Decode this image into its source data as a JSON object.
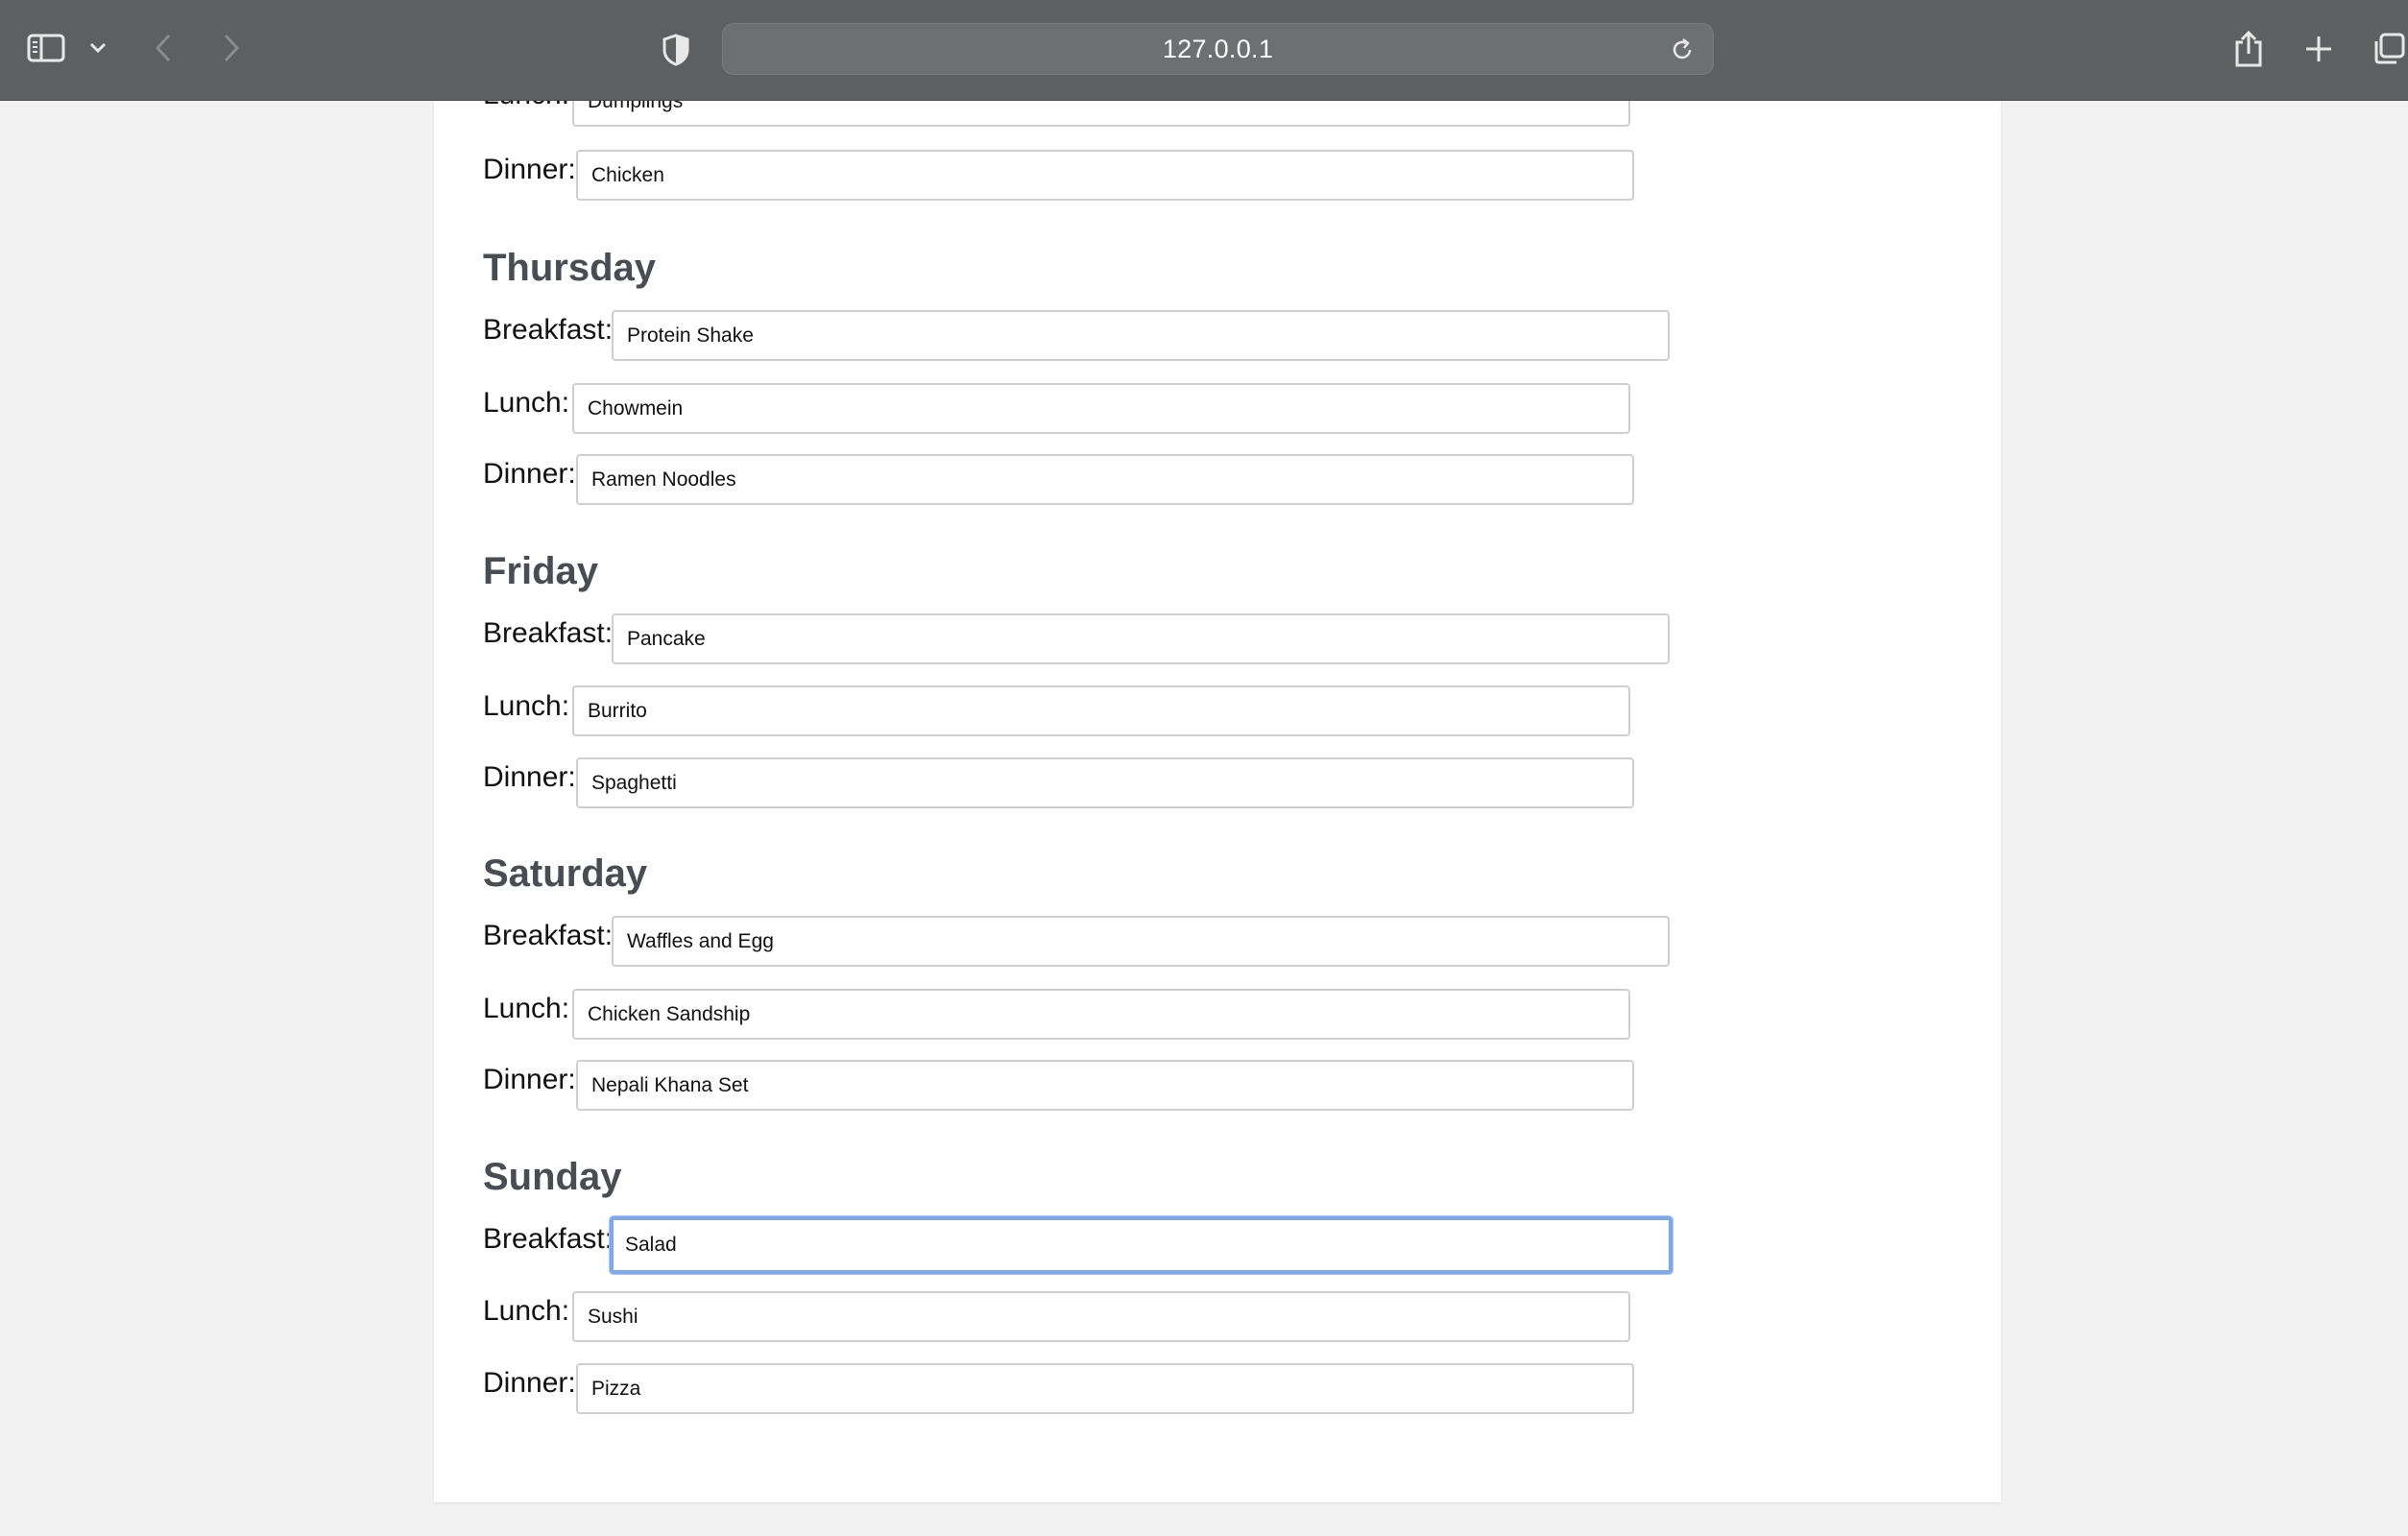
{
  "browser": {
    "url": "127.0.0.1",
    "icons": {
      "sidebar": "sidebar-icon",
      "chevron": "chevron-down-icon",
      "back": "back-icon",
      "forward": "forward-icon",
      "privacy": "shield-icon",
      "reload": "reload-icon",
      "share": "share-icon",
      "new_tab": "plus-icon",
      "tabs": "tab-overview-icon"
    }
  },
  "partial_top": {
    "lunch_label": "Lunch:",
    "lunch_value": "Dumplings",
    "dinner_label": "Dinner:",
    "dinner_value": "Chicken"
  },
  "days": [
    {
      "name": "Thursday",
      "breakfast_label": "Breakfast:",
      "breakfast": "Protein Shake",
      "lunch_label": "Lunch:",
      "lunch": "Chowmein",
      "dinner_label": "Dinner:",
      "dinner": "Ramen Noodles"
    },
    {
      "name": "Friday",
      "breakfast_label": "Breakfast:",
      "breakfast": "Pancake",
      "lunch_label": "Lunch:",
      "lunch": "Burrito",
      "dinner_label": "Dinner:",
      "dinner": "Spaghetti"
    },
    {
      "name": "Saturday",
      "breakfast_label": "Breakfast:",
      "breakfast": "Waffles and Egg",
      "lunch_label": "Lunch:",
      "lunch": "Chicken Sandship",
      "dinner_label": "Dinner:",
      "dinner": "Nepali Khana Set"
    },
    {
      "name": "Sunday",
      "breakfast_label": "Breakfast:",
      "breakfast": "Salad",
      "lunch_label": "Lunch:",
      "lunch": "Sushi",
      "dinner_label": "Dinner:",
      "dinner": "Pizza"
    }
  ],
  "colors": {
    "toolbar": "#5e5f61",
    "heading": "#484d54",
    "focus_ring": "#7fa9e8"
  }
}
